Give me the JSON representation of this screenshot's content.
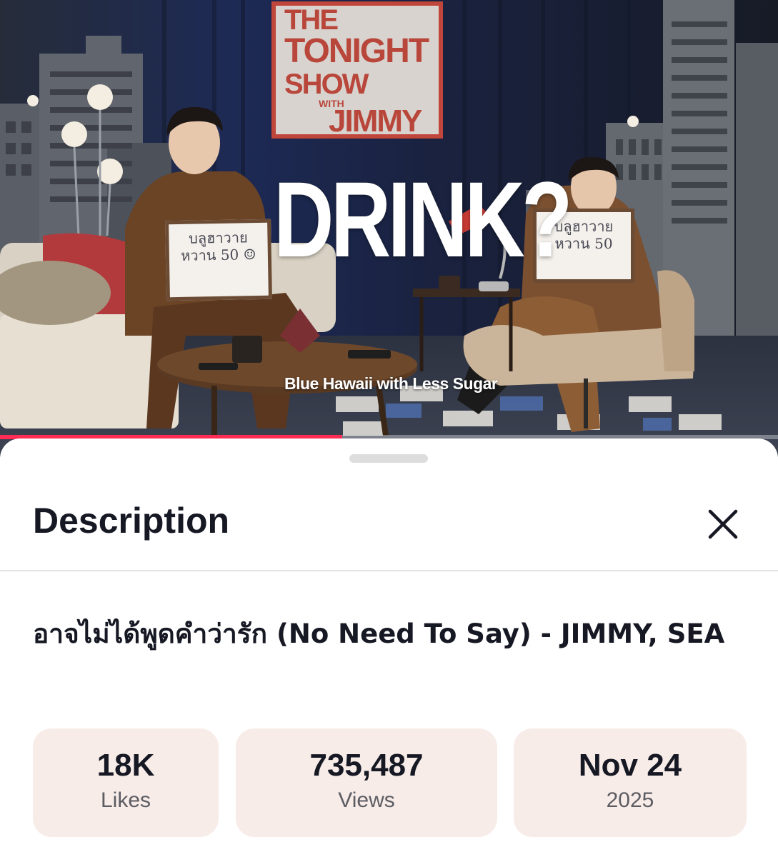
{
  "video": {
    "sign_lines": [
      "THE",
      "TONIGHT",
      "SHOW",
      "WITH",
      "JIMMY"
    ],
    "overlay_title": "DRINK?",
    "caption": "Blue Hawaii with Less Sugar",
    "board_left": "บลูฮาวาย หวาน 50 ☺",
    "board_right": "บลูฮาวาย หวาน 50",
    "progress_fraction": 0.44,
    "accent_color": "#fe2c55"
  },
  "sheet": {
    "title": "Description",
    "close_icon": "close-icon",
    "video_title": "อาจไม่ได้พูดคำว่ารัก (No Need To Say) - JIMMY, SEA",
    "stats": [
      {
        "value": "18K",
        "label": "Likes"
      },
      {
        "value": "735,487",
        "label": "Views"
      },
      {
        "value": "Nov 24",
        "label": "2025"
      }
    ]
  }
}
